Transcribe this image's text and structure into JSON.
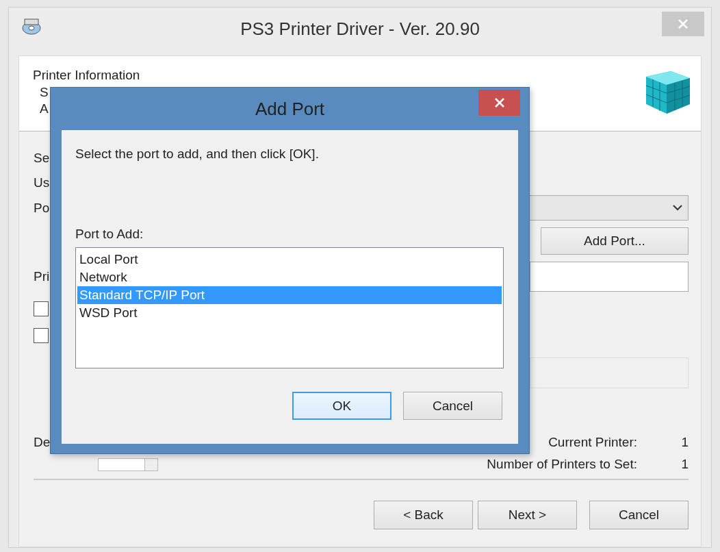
{
  "window": {
    "title": "PS3 Printer Driver - Ver. 20.90"
  },
  "header": {
    "title": "Printer Information",
    "lines": [
      "S",
      "A"
    ]
  },
  "form": {
    "labels": [
      "Se",
      "Us",
      "Po",
      "Pri",
      "De"
    ],
    "add_port_button": "Add Port...",
    "checkboxes": [
      {
        "checked": false
      },
      {
        "checked": false
      }
    ],
    "counts": [
      {
        "label": "Current Printer:",
        "value": "1"
      },
      {
        "label": "Number of Printers to Set:",
        "value": "1"
      }
    ]
  },
  "buttons": [
    {
      "label": "< Back"
    },
    {
      "label": "Next >"
    },
    {
      "label": "Cancel"
    }
  ],
  "dialog": {
    "title": "Add Port",
    "instruction": "Select the port to add, and then click [OK].",
    "list_label": "Port to Add:",
    "ports": [
      {
        "label": "Local Port",
        "selected": false
      },
      {
        "label": "Network",
        "selected": false
      },
      {
        "label": "Standard TCP/IP Port",
        "selected": true
      },
      {
        "label": "WSD Port",
        "selected": false
      }
    ],
    "buttons": [
      {
        "label": "OK",
        "default": true
      },
      {
        "label": "Cancel",
        "default": false
      }
    ]
  }
}
